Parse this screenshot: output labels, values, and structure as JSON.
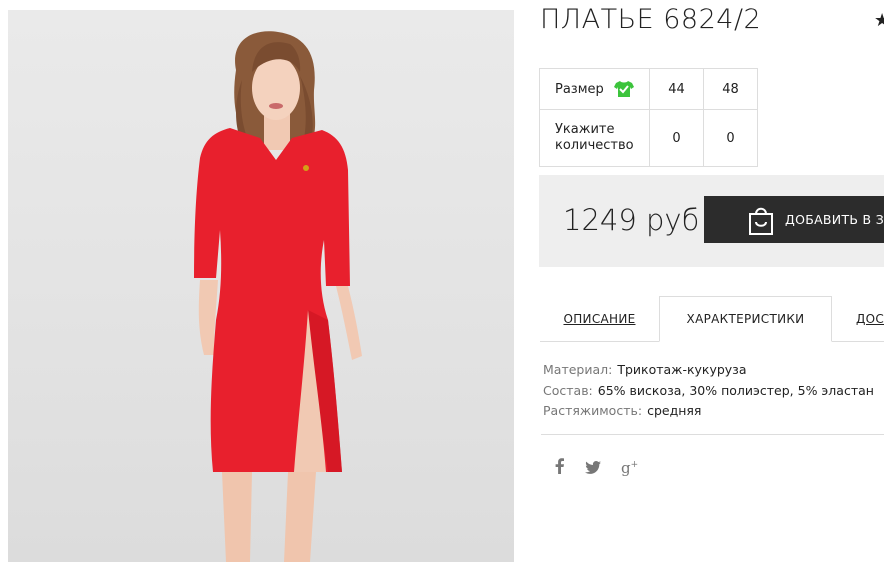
{
  "product": {
    "title": "ПЛАТЬЕ 6824/2",
    "favorite_icon": "star-icon",
    "image_alt": "Красное платье"
  },
  "size_table": {
    "size_label": "Размер",
    "size_icon": "tshirt-check-icon",
    "quantity_label": "Укажите количество",
    "sizes": [
      "44",
      "48"
    ],
    "quantities": [
      "0",
      "0"
    ]
  },
  "purchase": {
    "price": "1249 руб",
    "add_to_cart_label": "ДОБАВИТЬ В ЗАКАЗ",
    "cart_icon": "shopping-bag-icon"
  },
  "tabs": [
    {
      "label": "ОПИСАНИЕ"
    },
    {
      "label": "ХАРАКТЕРИСТИКИ",
      "active": true
    },
    {
      "label": "ДОСТАВКА"
    }
  ],
  "characteristics": [
    {
      "key": "Материал:",
      "value": "Трикотаж-кукуруза"
    },
    {
      "key": "Состав:",
      "value": "65% вискоза, 30% полиэстер, 5% эластан"
    },
    {
      "key": "Растяжимость:",
      "value": "средняя"
    }
  ],
  "social": [
    "facebook-icon",
    "twitter-icon",
    "google-plus-icon"
  ],
  "colors": {
    "dress": "#e8202d",
    "accent_green": "#3cc43c",
    "button_bg": "#2c2c2c",
    "buy_box_bg": "#eeeeee"
  }
}
